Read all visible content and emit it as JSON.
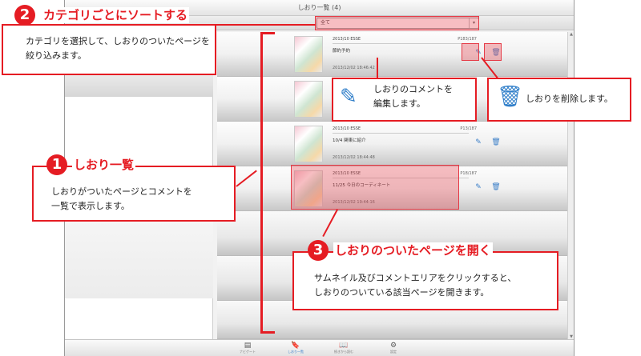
{
  "app": {
    "title": "しおり一覧 (4)",
    "filter": {
      "selected": "全て"
    },
    "rows": [
      {
        "date_label": "2013/10 ESSE",
        "page": "P183/187",
        "comment": "節約予約",
        "timestamp": "2013/12/02 18:46:42"
      },
      {
        "date_label": "",
        "page": "",
        "comment": "",
        "timestamp": ""
      },
      {
        "date_label": "2013/10 ESSE",
        "page": "P13/187",
        "comment": "10/4 関東に紹介",
        "timestamp": "2013/12/02 18:44:48"
      },
      {
        "date_label": "2013/10 ESSE",
        "page": "P18/187",
        "comment": "11/25 今日のコーディネート",
        "timestamp": "2013/12/02 19:44:16"
      }
    ],
    "bottom_nav": [
      {
        "label": "ナビゲート",
        "icon": "navigate-icon"
      },
      {
        "label": "しおり一覧",
        "icon": "bookmark-icon",
        "active": true
      },
      {
        "label": "続きから読む",
        "icon": "book-icon"
      },
      {
        "label": "設定",
        "icon": "gear-icon"
      }
    ]
  },
  "annotations": {
    "c1": {
      "num": "1",
      "title": "しおり一覧",
      "body1": "しおりがついたページとコメントを",
      "body2": "一覧で表示します。"
    },
    "c2": {
      "num": "2",
      "title": "カテゴリごとにソートする",
      "body1": "カテゴリを選択して、しおりのついたページを",
      "body2": "絞り込みます。"
    },
    "c3": {
      "num": "3",
      "title": "しおりのついたページを開く",
      "body1": "サムネイル及びコメントエリアをクリックすると、",
      "body2": "しおりのついている該当ページを開きます。"
    },
    "edit": {
      "body1": "しおりのコメントを",
      "body2": "編集します。"
    },
    "delete": {
      "body": "しおりを削除します。"
    }
  },
  "colors": {
    "accent": "#e51c23",
    "icon_blue": "#2f7ec9"
  }
}
